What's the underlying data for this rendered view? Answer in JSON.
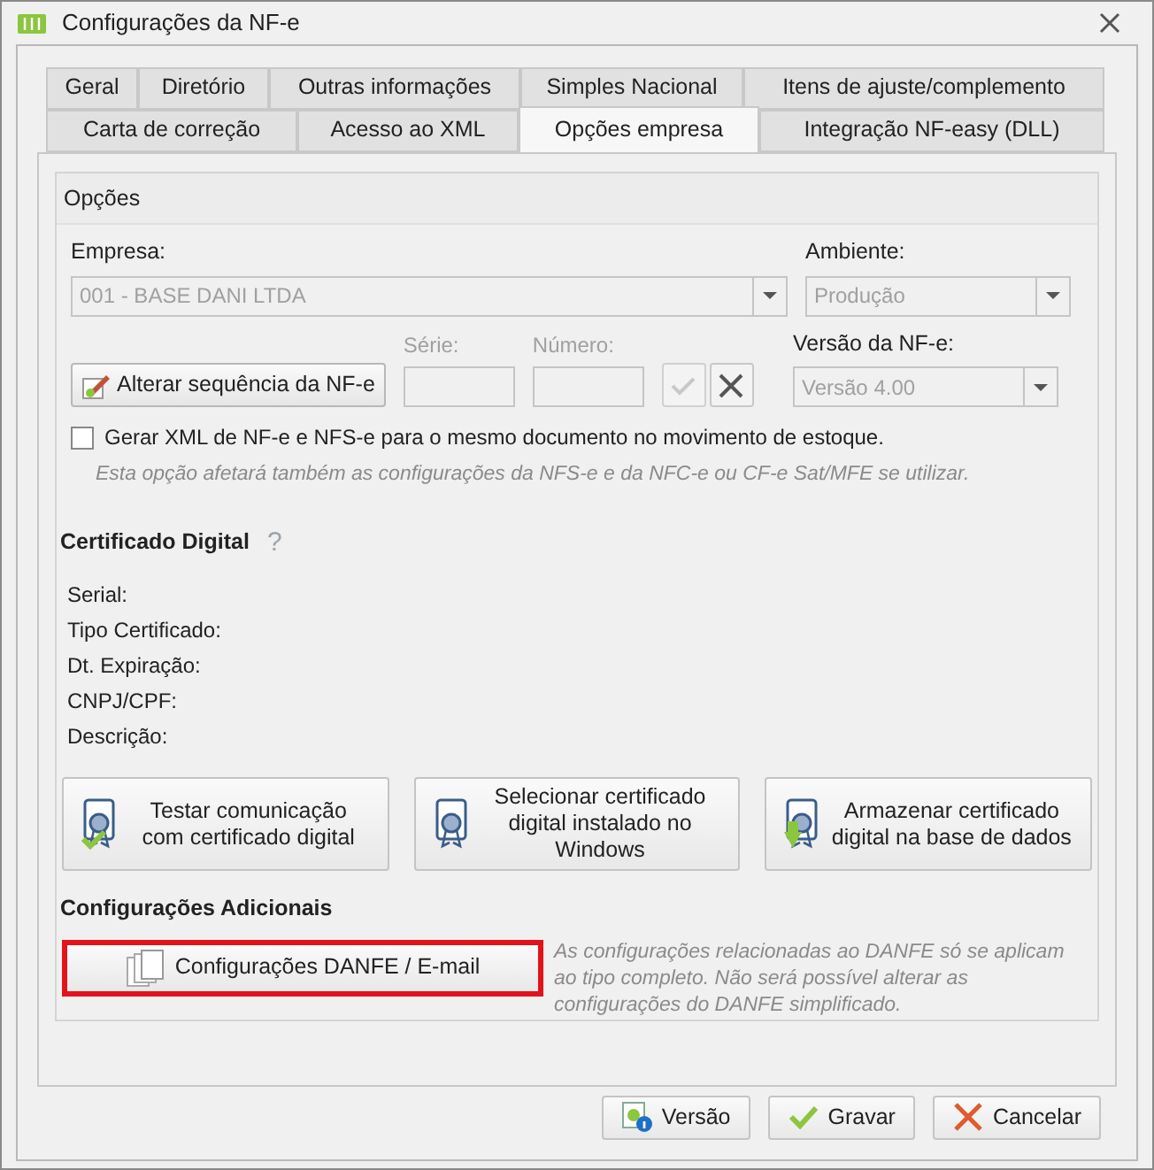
{
  "window": {
    "title": "Configurações da NF-e"
  },
  "tab_rows": [
    [
      {
        "label": "Geral",
        "selected": false
      },
      {
        "label": "Diretório",
        "selected": false
      },
      {
        "label": "Outras informações",
        "selected": false
      },
      {
        "label": "Simples Nacional",
        "selected": false
      },
      {
        "label": "Itens de ajuste/complemento",
        "selected": false
      }
    ],
    [
      {
        "label": "Carta de correção",
        "selected": false
      },
      {
        "label": "Acesso ao XML",
        "selected": false
      },
      {
        "label": "Opções empresa",
        "selected": true
      },
      {
        "label": "Integração NF-easy (DLL)",
        "selected": false
      }
    ]
  ],
  "options": {
    "title": "Opções",
    "empresa": {
      "label": "Empresa:",
      "value": "001 - BASE DANI LTDA",
      "disabled": true
    },
    "ambiente": {
      "label": "Ambiente:",
      "value": "Produção",
      "disabled": true
    },
    "alterar_button": "Alterar sequência da NF-e",
    "serie": {
      "label": "Série:",
      "disabled": true
    },
    "numero": {
      "label": "Número:",
      "disabled": true
    },
    "confirm_disabled": true,
    "cancel_disabled": false,
    "versao": {
      "label": "Versão da NF-e:",
      "value": "Versão 4.00",
      "disabled": true
    },
    "gerar_xml": {
      "label": "Gerar XML de NF-e e NFS-e para o mesmo documento no movimento de estoque.",
      "checked": false
    },
    "note": "Esta opção afetará também as configurações da NFS-e e da NFC-e ou CF-e Sat/MFE se utilizar."
  },
  "certificado": {
    "title": "Certificado Digital",
    "help": "?",
    "fields": [
      "Serial:",
      "Tipo Certificado:",
      "Dt. Expiração:",
      "CNPJ/CPF:",
      "Descrição:"
    ],
    "buttons": [
      {
        "kind": "test",
        "label": "Testar comunicação com certificado digital"
      },
      {
        "kind": "select",
        "label": "Selecionar certificado digital instalado no Windows"
      },
      {
        "kind": "store",
        "label": "Armazenar certificado digital na base de dados"
      }
    ]
  },
  "adicionais": {
    "title": "Configurações Adicionais",
    "button": {
      "label": "Configurações DANFE / E-mail",
      "highlighted": true
    },
    "note": "As configurações relacionadas ao DANFE só se aplicam ao tipo completo. Não será possível alterar as configurações do DANFE simplificado."
  },
  "footer_buttons": [
    {
      "kind": "version",
      "label": "Versão"
    },
    {
      "kind": "save",
      "label": "Gravar"
    },
    {
      "kind": "cancel",
      "label": "Cancelar"
    }
  ]
}
